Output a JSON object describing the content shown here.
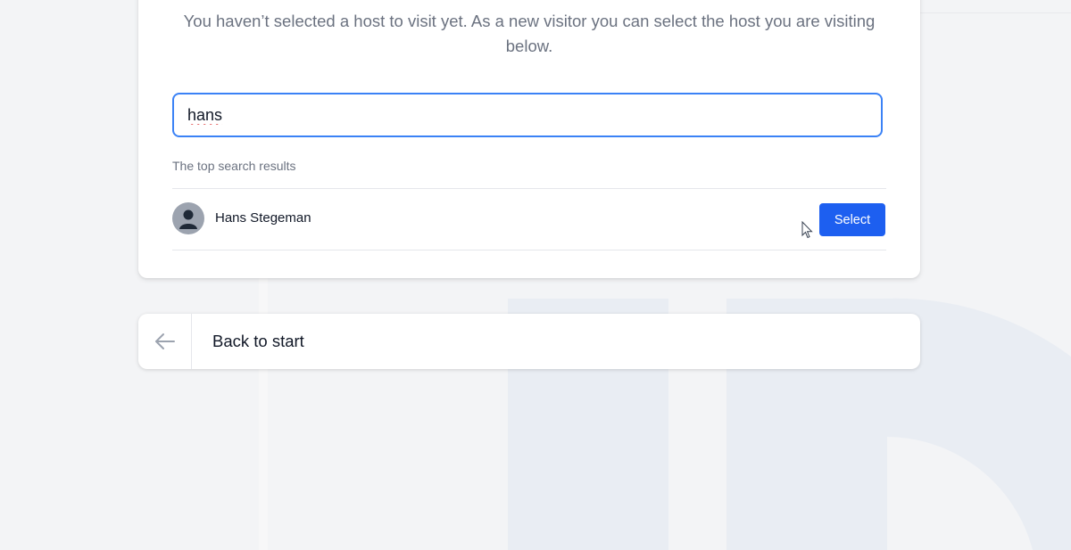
{
  "card": {
    "intro_text": "You haven’t selected a host to visit yet. As a new visitor you can select the host you are visiting below.",
    "search": {
      "value": "hans"
    },
    "results_label": "The top search results",
    "results": [
      {
        "name": "Hans Stegeman",
        "button_label": "Select"
      }
    ]
  },
  "back": {
    "label": "Back to start",
    "icon": "arrow-left-icon"
  },
  "colors": {
    "accent": "#1d5ff0",
    "focus_ring": "#3b82f6",
    "background": "#f3f4f6",
    "decor": "#e9edf3"
  }
}
